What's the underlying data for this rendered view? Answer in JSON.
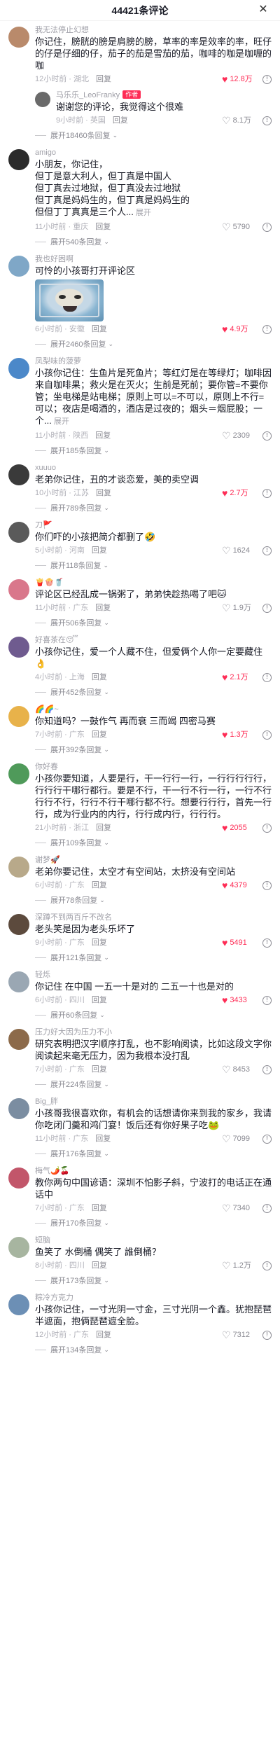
{
  "header": {
    "title": "44421条评论",
    "close_label": "✕"
  },
  "comments": [
    {
      "username": "我无法停止幻想",
      "avatar_color": "#b98a6b",
      "text": "你记住，膀胱的膀是肩膀的膀，草率的率是效率的率，旺仔的仔是仔细的仔，茄子的茄是雪茄的茄，咖啡的咖是咖喱的咖",
      "time": "12小时前 · 湖北",
      "reply": "回复",
      "likes": "12.8万",
      "liked": true,
      "sub": {
        "username": "马乐乐_LeoFranky",
        "tag": "作者",
        "avatar_color": "#6a6a6a",
        "text": "谢谢您的评论，我觉得这个很难",
        "time": "9小时前 · 英国",
        "reply": "回复",
        "likes": "8.1万",
        "liked": false
      },
      "more": "展开18460条回复"
    },
    {
      "username": "amigo",
      "avatar_color": "#2b2b2b",
      "text": "小朋友，你记住，\n但丁是意大利人，但丁真是中国人\n但丁真去过地狱，但丁真没去过地狱\n但丁真是妈妈生的，但丁真是妈妈生的\n但但丁丁真真是三个人...",
      "expand": "展开",
      "time": "11小时前 · 重庆",
      "reply": "回复",
      "likes": "5790",
      "liked": false,
      "more": "展开540条回复"
    },
    {
      "username": "我也好困啊",
      "avatar_color": "#7fa7c7",
      "text": "可怜的小孩哥打开评论区",
      "has_image": true,
      "time": "6小时前 · 安徽",
      "reply": "回复",
      "likes": "4.9万",
      "liked": true,
      "more": "展开2460条回复"
    },
    {
      "username": "凤梨味的菠萝",
      "avatar_color": "#4b88c9",
      "text": "小孩你记住：生鱼片是死鱼片；等红灯是在等绿灯；咖啡因来自咖啡果；救火是在灭火；生前是死前；要你管=不要你管；坐电梯是站电梯；原则上可以=不可以，原则上不行=可以；夜店是喝酒的，酒店是过夜的；烟头＝烟屁股；一个...",
      "expand": "展开",
      "time": "11小时前 · 陕西",
      "reply": "回复",
      "likes": "2309",
      "liked": false,
      "more": "展开185条回复"
    },
    {
      "username": "xuuuo",
      "avatar_color": "#3a3a3a",
      "text": "老弟你记住，丑的才谈恋爱，美的卖空调",
      "time": "10小时前 · 江苏",
      "reply": "回复",
      "likes": "2.7万",
      "liked": true,
      "more": "展开789条回复"
    },
    {
      "username": "刀🚩",
      "avatar_color": "#5a5a5a",
      "text": "你们吓的小孩把简介都删了🤣",
      "time": "5小时前 · 河南",
      "reply": "回复",
      "likes": "1624",
      "liked": false,
      "more": "展开118条回复"
    },
    {
      "username": "🍟🍿🥤",
      "avatar_color": "#d9778b",
      "text": "评论区已经乱成一锅粥了，弟弟快趁热喝了吧🐱",
      "time": "11小时前 · 广东",
      "reply": "回复",
      "likes": "1.9万",
      "liked": false,
      "more": "展开506条回复"
    },
    {
      "username": "好喜茶在😴",
      "avatar_color": "#6f5b8f",
      "text": "小孩你记住，爱一个人藏不住，但爱俩个人你一定要藏住👌",
      "time": "4小时前 · 上海",
      "reply": "回复",
      "likes": "2.1万",
      "liked": true,
      "more": "展开452条回复"
    },
    {
      "username": "🌈🌈~",
      "avatar_color": "#e8b24a",
      "text": "你知道吗？一鼓作气 再而衰 三而竭 四密马赛",
      "time": "7小时前 · 广东",
      "reply": "回复",
      "likes": "1.3万",
      "liked": true,
      "more": "展开392条回复"
    },
    {
      "username": "你好春",
      "avatar_color": "#4f9a5a",
      "text": "小孩你要知道，人要是行，干一行行一行，一行行行行行，行行行干哪行都行。要是不行，干一行不行一行，一行不行行行不行，行行不行干哪行都不行。想要行行行，首先一行行，成为行业内的内行，行行成内行，行行行。",
      "time": "21小时前 · 浙江",
      "reply": "回复",
      "likes": "2055",
      "liked": true,
      "more": "展开109条回复"
    },
    {
      "username": "谢梦🚀",
      "avatar_color": "#b8a98a",
      "text": "老弟你要记住，太空才有空间站，太挤没有空间站",
      "time": "6小时前 · 广东",
      "reply": "回复",
      "likes": "4379",
      "liked": true,
      "more": "展开78条回复"
    },
    {
      "username": "深蹲不到两百斤不改名",
      "avatar_color": "#5c4a3d",
      "text": "老头笑是因为老头乐坏了",
      "time": "9小时前 · 广东",
      "reply": "回复",
      "likes": "5491",
      "liked": true,
      "more": "展开121条回复"
    },
    {
      "username": "轻烁",
      "avatar_color": "#9aa7b3",
      "text": "你记住 在中国 一五一十是对的 二五一十也是对的",
      "time": "6小时前 · 四川",
      "reply": "回复",
      "likes": "3433",
      "liked": true,
      "more": "展开60条回复"
    },
    {
      "username": "压力好大因为压力不小",
      "avatar_color": "#8c6a4a",
      "text": "研究表明把汉字顺序打乱，也不影响阅读，比如这段文字你阅读起来毫无压力，因为我根本没打乱",
      "time": "7小时前 · 广东",
      "reply": "回复",
      "likes": "8453",
      "liked": false,
      "more": "展开224条回复"
    },
    {
      "username": "Big_胖",
      "avatar_color": "#7b8da1",
      "text": "小孩哥我很喜欢你，有机会的话想请你来到我的家乡，我请你吃闭门羹和鸿门宴！饭后还有你好果子吃🐸",
      "time": "11小时前 · 广东",
      "reply": "回复",
      "likes": "7099",
      "liked": false,
      "more": "展开176条回复"
    },
    {
      "username": "梅气🌶️🍒",
      "avatar_color": "#c2566a",
      "text": "教你两句中国谚语：深圳不怕影子斜，宁波打的电话正在通话中",
      "time": "7小时前 · 广东",
      "reply": "回复",
      "likes": "7340",
      "liked": false,
      "more": "展开170条回复"
    },
    {
      "username": "短脑",
      "avatar_color": "#a7b5a0",
      "text": "鱼笑了 水倒桶 偶笑了 誰倒桶？",
      "time": "8小时前 · 四川",
      "reply": "回复",
      "likes": "1.2万",
      "liked": false,
      "more": "展开173条回复"
    },
    {
      "username": "粽冷方克力",
      "avatar_color": "#6c8fb5",
      "text": "小孩你记住，一寸光阴一寸金，三寸光阴一个鑫。犹抱琵琶半遮面，抱俩琵琶遮全脸。",
      "time": "12小时前 · 广东",
      "reply": "回复",
      "likes": "7312",
      "liked": false,
      "more": "展开134条回复"
    }
  ],
  "colors": {
    "accent": "#fe2c55",
    "muted": "#a0a0a8",
    "text": "#161823"
  }
}
